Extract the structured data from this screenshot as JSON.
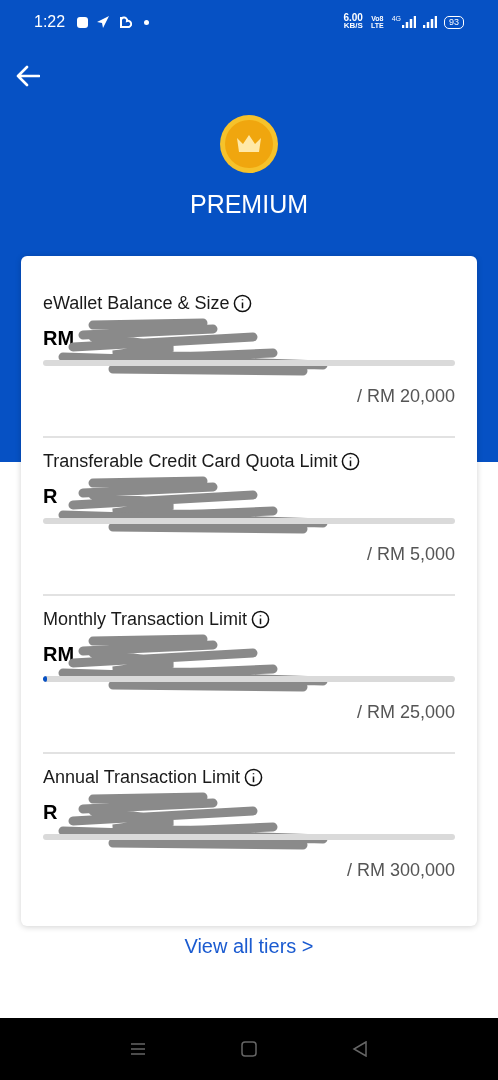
{
  "status_bar": {
    "time": "1:22",
    "speed": "6.00",
    "speed_unit": "KB/S",
    "volte_top": "Vo8",
    "volte_bottom": "LTE",
    "network": "4G",
    "battery": "93"
  },
  "header": {
    "tier": "PREMIUM"
  },
  "limits": [
    {
      "title": "eWallet Balance & Size",
      "amount": "RM",
      "redacted": true,
      "maximum": "/ RM 20,000"
    },
    {
      "title": "Transferable Credit Card Quota Limit",
      "amount": "R",
      "redacted": true,
      "maximum": "/ RM 5,000"
    },
    {
      "title": "Monthly Transaction Limit",
      "amount": "RM",
      "redacted": true,
      "level": 0.01,
      "maximum": "/ RM 25,000"
    },
    {
      "title": "Annual Transaction Limit",
      "amount": "R",
      "redacted": true,
      "maximum": "/ RM 300,000"
    }
  ],
  "view_all_link": "View all tiers >"
}
